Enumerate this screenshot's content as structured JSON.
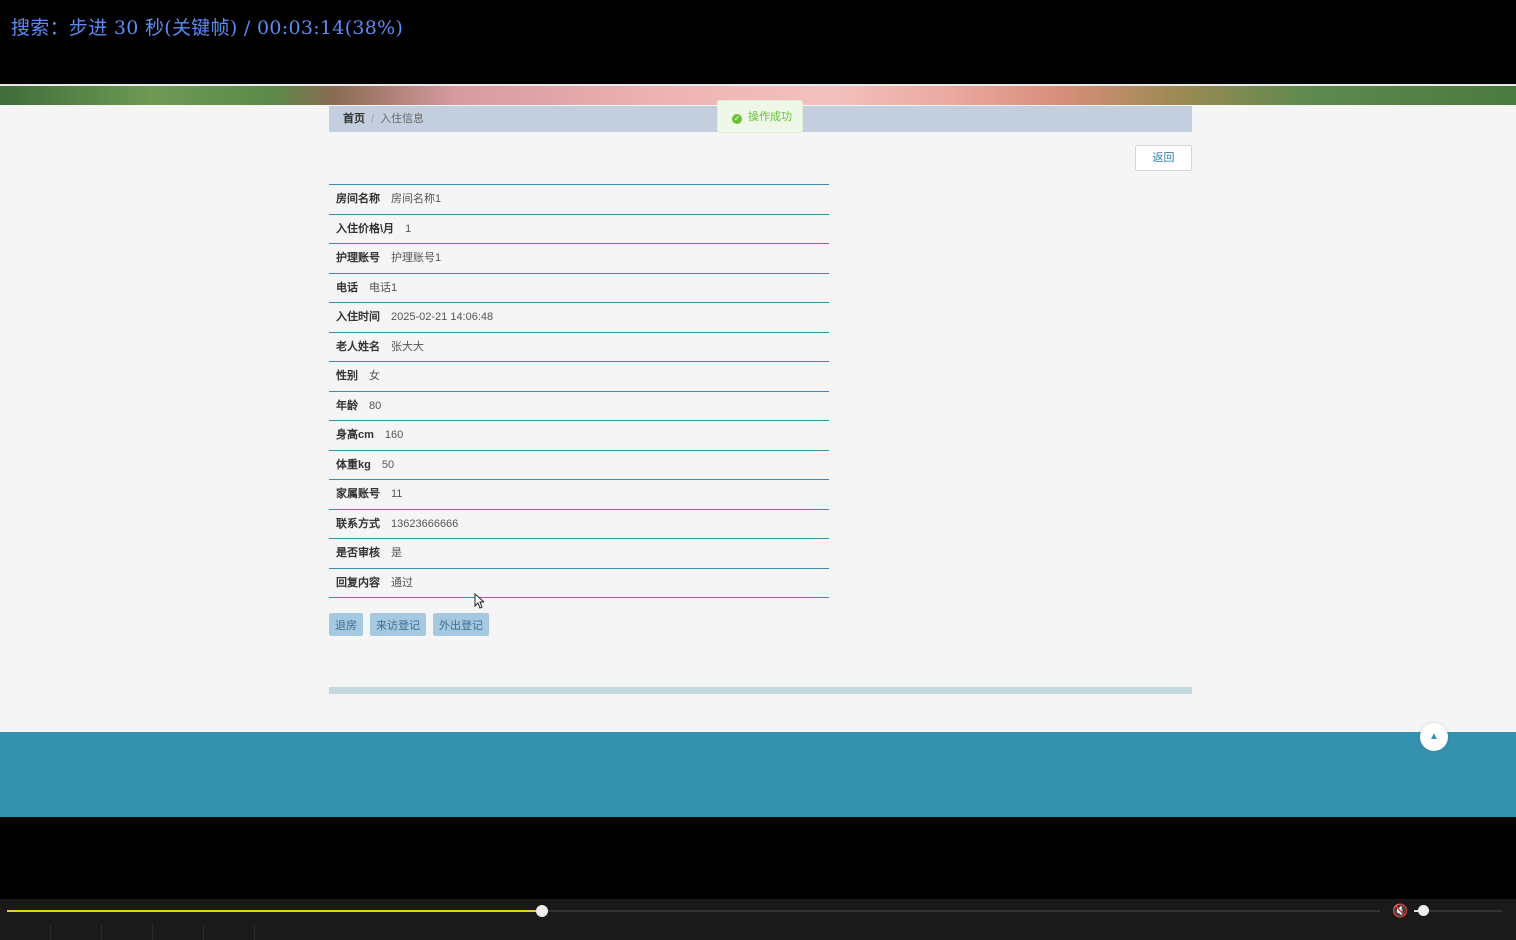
{
  "osd": {
    "text": "搜索：步进 30 秒(关键帧) / 00:03:14(38%)"
  },
  "breadcrumb": {
    "home": "首页",
    "separator": "/",
    "current": "入住信息"
  },
  "toast": {
    "text": "操作成功",
    "color": "#67c23a"
  },
  "back_button": {
    "label": "返回"
  },
  "details": [
    {
      "label": "房间名称",
      "value": "房间名称1"
    },
    {
      "label": "入住价格\\月",
      "value": "1"
    },
    {
      "label": "护理账号",
      "value": "护理账号1"
    },
    {
      "label": "电话",
      "value": "电话1"
    },
    {
      "label": "入住时间",
      "value": "2025-02-21 14:06:48"
    },
    {
      "label": "老人姓名",
      "value": "张大大"
    },
    {
      "label": "性别",
      "value": "女"
    },
    {
      "label": "年龄",
      "value": "80"
    },
    {
      "label": "身高cm",
      "value": "160"
    },
    {
      "label": "体重kg",
      "value": "50"
    },
    {
      "label": "家属账号",
      "value": "11"
    },
    {
      "label": "联系方式",
      "value": "13623666666"
    },
    {
      "label": "是否审核",
      "value": "是"
    },
    {
      "label": "回复内容",
      "value": "通过"
    }
  ],
  "actions": {
    "checkout": "退房",
    "visit_register": "来访登记",
    "outing_register": "外出登记"
  },
  "player": {
    "progress_fraction": 0.39,
    "volume_fraction": 0.1,
    "accent": "#e7d31a"
  },
  "colors": {
    "footer": "#3592ae",
    "row_border": "#3a8fa8",
    "breadcrumb_bg": "#c3cfdf"
  }
}
